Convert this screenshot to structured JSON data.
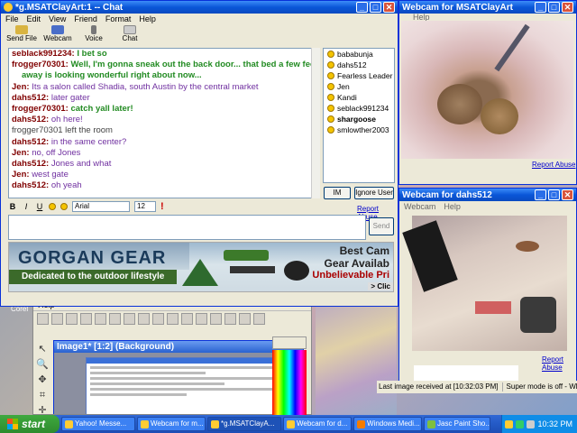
{
  "desktop": {
    "label": "Corel"
  },
  "paint": {
    "menu": [
      "Help"
    ],
    "image_window_title": "Image1* [1:2] (Background)"
  },
  "cam1": {
    "title": "Webcam for MSATClayArt",
    "menu": [
      "Help"
    ],
    "report_abuse": "Report Abuse"
  },
  "cam2": {
    "title": "Webcam for dahs512",
    "menu": [
      "Webcam",
      "Help"
    ],
    "report_abuse": "Report Abuse",
    "status": [
      "Last image received at [10:32:03 PM]",
      "Super mode is off - What's this?"
    ]
  },
  "chat": {
    "title": "*g.MSATClayArt:1 -- Chat",
    "menu": [
      "File",
      "Edit",
      "View",
      "Friend",
      "Format",
      "Help"
    ],
    "toolbar": [
      "Send File",
      "Webcam",
      "Voice",
      "Chat"
    ],
    "messages": [
      {
        "nick": "seblack991234:",
        "text": "I bet so",
        "style": "green"
      },
      {
        "nick": "frogger70301:",
        "text": "Well, I'm gonna sneak out the back door... that bed a few feet",
        "style": "green"
      },
      {
        "nick": "",
        "text": "away is looking wonderful right about now...",
        "style": "green"
      },
      {
        "nick": "Jen:",
        "text": "Its a salon called Shadia, south Austin by the central market",
        "style": "purple"
      },
      {
        "nick": "dahs512:",
        "text": "later gater",
        "style": "purple"
      },
      {
        "nick": "frogger70301:",
        "text": "catch yall later!",
        "style": "green"
      },
      {
        "nick": "dahs512:",
        "text": "oh here!",
        "style": "purple"
      },
      {
        "nick": "",
        "text": "frogger70301 left the room",
        "style": "sys"
      },
      {
        "nick": "dahs512:",
        "text": "in the same center?",
        "style": "purple"
      },
      {
        "nick": "Jen:",
        "text": "no, off Jones",
        "style": "purple"
      },
      {
        "nick": "dahs512:",
        "text": "Jones and what",
        "style": "purple"
      },
      {
        "nick": "Jen:",
        "text": "west gate",
        "style": "purple"
      },
      {
        "nick": "dahs512:",
        "text": "oh yeah",
        "style": "purple"
      }
    ],
    "users": [
      "bababunja",
      "dahs512",
      "Fearless Leader",
      "Jen",
      "Kandi",
      "seblack991234",
      "shargoose",
      "smlowther2003"
    ],
    "im_button": "IM",
    "ignore_button": "Ignore User",
    "font_select": "Arial",
    "size_select": "12",
    "report_abuse": "Report Abuse",
    "send_button": "Send",
    "ad": {
      "brand": "GORGAN GEAR",
      "tagline": "Dedicated to the outdoor lifestyle",
      "line1": "Best Cam",
      "line2": "Gear Availab",
      "line3": "Unbelievable Pri",
      "cta": "> Clic"
    }
  },
  "taskbar": {
    "start": "start",
    "tasks": [
      "Yahoo! Messe...",
      "Webcam for m...",
      "*g.MSATClayA...",
      "Webcam for d...",
      "Windows Medi...",
      "Jasc Paint Sho..."
    ],
    "clock": "10:32 PM"
  }
}
